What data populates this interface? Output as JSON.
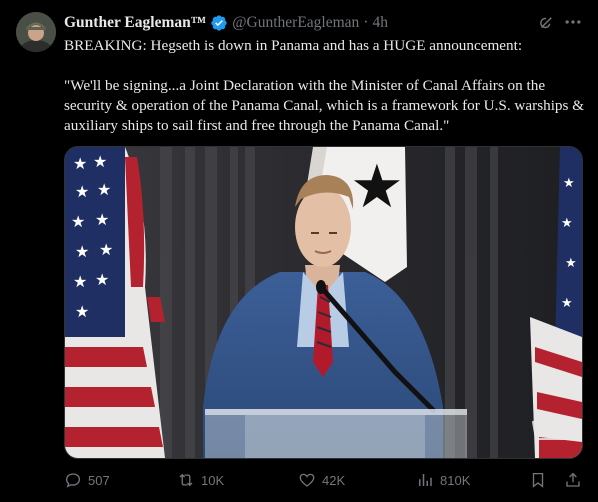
{
  "author": {
    "name": "Gunther Eagleman™",
    "handle": "@GuntherEagleman",
    "time": "4h"
  },
  "post": {
    "line1": "BREAKING: Hegseth is down in Panama and has a HUGE announcement:",
    "quote": "\"We'll be signing...a Joint Declaration with the Minister of Canal Affairs on the security & operation of the Panama Canal, which is a framework for U.S. warships & auxiliary ships to sail first and free through the Panama Canal.\""
  },
  "metrics": {
    "replies": "507",
    "reposts": "10K",
    "likes": "42K",
    "views": "810K"
  },
  "colors": {
    "background": "#000000",
    "text": "#e7e9ea",
    "muted": "#71767b",
    "verified": "#1d9bf0"
  },
  "icons": [
    "verified-badge-icon",
    "grok-icon",
    "more-icon",
    "reply-icon",
    "repost-icon",
    "like-icon",
    "views-icon",
    "bookmark-icon",
    "share-icon"
  ]
}
